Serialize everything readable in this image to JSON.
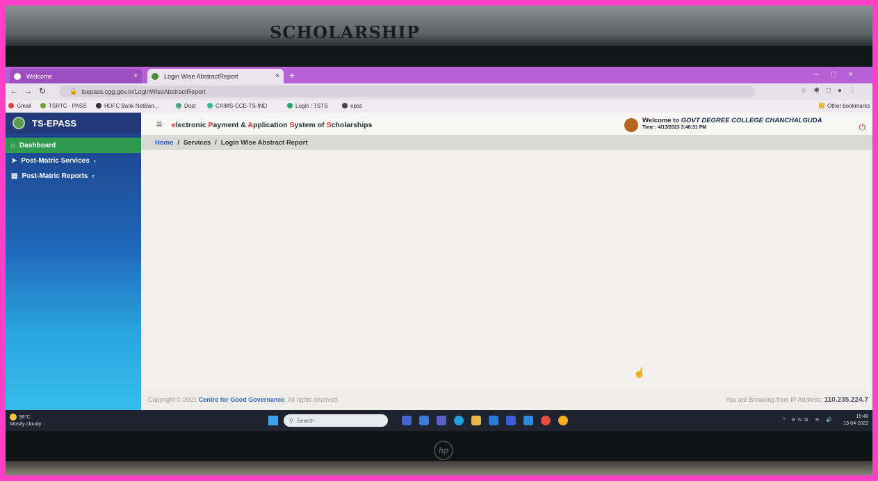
{
  "wall": {
    "sign": "SCHOLARSHIP"
  },
  "browser": {
    "tabs": [
      {
        "label": "Welcome",
        "active": false
      },
      {
        "label": "Login Wise AbstractReport",
        "active": true
      }
    ],
    "new_tab": "+",
    "url": "tsepass.cgg.gov.in/LoginWiseAbstractReport",
    "bookmarks": [
      "Gmail",
      "TSRTC - PASS",
      "HDFC Bank NetBan...",
      "Dost",
      "CAIMS-CCE-TS-IND",
      "Login : TSTS",
      "epss"
    ],
    "other_bookmarks": "Other bookmarks"
  },
  "app": {
    "brand": "TS-EPASS",
    "title_parts": [
      "e",
      "lectronic ",
      "P",
      "ayment & ",
      "A",
      "pplication ",
      "S",
      "ystem of ",
      "S",
      "cholarships"
    ],
    "welcome_prefix": "Welcome to ",
    "college": "GOVT DEGREE COLLEGE CHANCHALGUDA",
    "time": "Time : 4/13/2023 3:48:31 PM",
    "menu": [
      {
        "label": "Dashboard",
        "icon": "home-icon",
        "active": true
      },
      {
        "label": "Post-Matric Services",
        "icon": "send-icon",
        "caret": "‹"
      },
      {
        "label": "Post-Matric Reports",
        "icon": "report-icon",
        "caret": "‹"
      }
    ],
    "breadcrumb": {
      "home": "Home",
      "sep": "/",
      "services": "Services",
      "current": "Login Wise Abstract Report"
    },
    "footer": {
      "copyright_prefix": "Copyright © 2021 ",
      "org": "Centre for Good Governance",
      "copyright_suffix": ". All rights reserved.",
      "ip_label": "You are Browsing from IP Address: ",
      "ip": "110.235.224.7"
    }
  },
  "taskbar": {
    "temp": "38°C",
    "weather": "Mostly cloudy",
    "search_placeholder": "Search",
    "lang": "ENG",
    "region": "IN",
    "time": "15:48",
    "date": "13-04-2023"
  },
  "colors": {
    "accent_red": "#e02a2a",
    "sidebar_active": "#2f9a4d",
    "link_blue": "#2b55c9"
  }
}
